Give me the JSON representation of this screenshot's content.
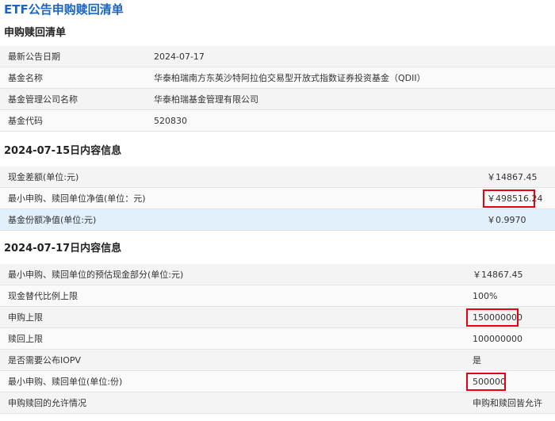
{
  "page_title": "ETF公告申购赎回清单",
  "section1": {
    "title": "申购赎回清单",
    "rows": [
      {
        "label": "最新公告日期",
        "value": "2024-07-17"
      },
      {
        "label": "基金名称",
        "value": "华泰柏瑞南方东英沙特阿拉伯交易型开放式指数证券投资基金（QDII）"
      },
      {
        "label": "基金管理公司名称",
        "value": "华泰柏瑞基金管理有限公司"
      },
      {
        "label": "基金代码",
        "value": "520830"
      }
    ]
  },
  "section2": {
    "title": "2024-07-15日内容信息",
    "rows": [
      {
        "label": "现金差额(单位:元)",
        "value": "￥14867.45"
      },
      {
        "label": "最小申购、赎回单位净值(单位：元)",
        "value": "￥498516.24"
      },
      {
        "label": "基金份额净值(单位:元)",
        "value": "￥0.9970"
      }
    ]
  },
  "section3": {
    "title": "2024-07-17日内容信息",
    "rows": [
      {
        "label": "最小申购、赎回单位的预估现金部分(单位:元)",
        "value": "￥14867.45"
      },
      {
        "label": "现金替代比例上限",
        "value": "100%"
      },
      {
        "label": "申购上限",
        "value": "150000000"
      },
      {
        "label": "赎回上限",
        "value": "100000000"
      },
      {
        "label": "是否需要公布IOPV",
        "value": "是"
      },
      {
        "label": "最小申购、赎回单位(单位:份)",
        "value": "500000"
      },
      {
        "label": "申购赎回的允许情况",
        "value": "申购和赎回皆允许"
      }
    ]
  },
  "colors": {
    "title": "#1a66c6",
    "highlight_box": "#e60012",
    "highlight_row": "#e1f0fb"
  }
}
